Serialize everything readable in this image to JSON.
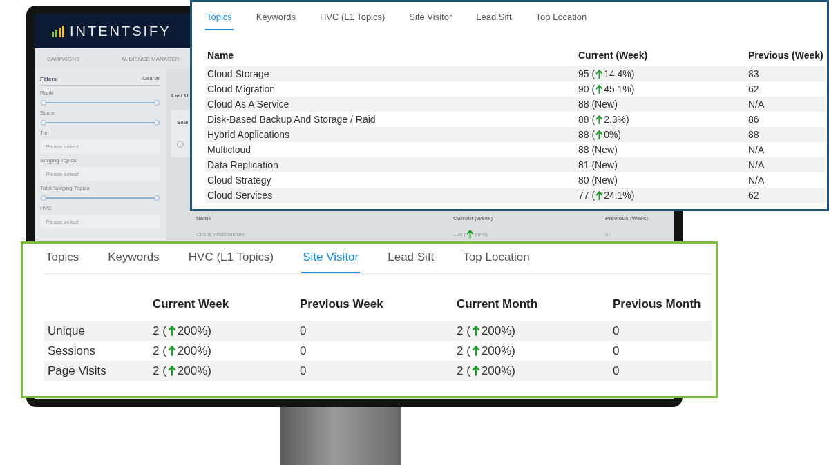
{
  "background_app": {
    "logo": "INTENTSIFY",
    "nav": [
      "CAMPAIGNS",
      "AUDIENCE MANAGER"
    ],
    "filters": {
      "title": "Filters",
      "clear": "Clear all",
      "items": [
        {
          "kind": "range",
          "label": "Rank",
          "level": 1
        },
        {
          "kind": "range",
          "label": "Score",
          "level": 1
        },
        {
          "kind": "select",
          "label": "Tier",
          "placeholder": "Please select"
        },
        {
          "kind": "select",
          "label": "Surging Topics",
          "placeholder": "Please select"
        },
        {
          "kind": "range",
          "label": "Total Surging Topics",
          "level": 1
        },
        {
          "kind": "select",
          "label": "HVC",
          "placeholder": "Please select"
        }
      ]
    },
    "main_fragments": {
      "heading": "Last U",
      "column": "Sele",
      "radio_selected": false
    },
    "table": {
      "columns": [
        "Name",
        "Current (Week)",
        "Previous (Week)"
      ],
      "rows": [
        {
          "name": "Cloud Infrastructure",
          "current": {
            "before": "100 (",
            "up": true,
            "after": "66%)"
          },
          "previous": "60"
        }
      ]
    }
  },
  "topics_panel": {
    "tabs": [
      {
        "label": "Topics",
        "selected": true
      },
      {
        "label": "Keywords",
        "selected": false
      },
      {
        "label": "HVC (L1 Topics)",
        "selected": false
      },
      {
        "label": "Site Visitor",
        "selected": false
      },
      {
        "label": "Lead Sift",
        "selected": false
      },
      {
        "label": "Top Location",
        "selected": false
      }
    ],
    "columns": [
      "Name",
      "Current (Week)",
      "Previous (Week)"
    ],
    "rows": [
      {
        "name": "Cloud Storage",
        "current": {
          "before": "95 (",
          "up": true,
          "after": "14.4%)"
        },
        "previous": "83"
      },
      {
        "name": "Cloud Migration",
        "current": {
          "before": "90 (",
          "up": true,
          "after": "45.1%)"
        },
        "previous": "62"
      },
      {
        "name": "Cloud As A Service",
        "current": {
          "before": "88 (New)",
          "up": false
        },
        "previous": "N/A"
      },
      {
        "name": "Disk-Based Backup And Storage / Raid",
        "current": {
          "before": "88 (",
          "up": true,
          "after": "2.3%)"
        },
        "previous": "86"
      },
      {
        "name": "Hybrid Applications",
        "current": {
          "before": "88 (",
          "up": true,
          "after": "0%)"
        },
        "previous": "88"
      },
      {
        "name": "Multicloud",
        "current": {
          "before": "88 (New)",
          "up": false
        },
        "previous": "N/A"
      },
      {
        "name": "Data Replication",
        "current": {
          "before": "81 (New)",
          "up": false
        },
        "previous": "N/A"
      },
      {
        "name": "Cloud Strategy",
        "current": {
          "before": "80 (New)",
          "up": false
        },
        "previous": "N/A"
      },
      {
        "name": "Cloud Services",
        "current": {
          "before": "77 (",
          "up": true,
          "after": "24.1%)"
        },
        "previous": "62"
      }
    ]
  },
  "site_visitor_panel": {
    "tabs": [
      {
        "label": "Topics",
        "selected": false
      },
      {
        "label": "Keywords",
        "selected": false
      },
      {
        "label": "HVC (L1 Topics)",
        "selected": false
      },
      {
        "label": "Site Visitor",
        "selected": true
      },
      {
        "label": "Lead Sift",
        "selected": false
      },
      {
        "label": "Top Location",
        "selected": false
      }
    ],
    "columns": [
      "Current Week",
      "Previous Week",
      "Current Month",
      "Previous Month"
    ],
    "rows": [
      {
        "label": "Unique",
        "cells": [
          {
            "before": "2 (",
            "up": true,
            "after": "200%)"
          },
          {
            "before": "0",
            "up": false
          },
          {
            "before": "2 (",
            "up": true,
            "after": "200%)"
          },
          {
            "before": "0",
            "up": false
          }
        ]
      },
      {
        "label": "Sessions",
        "cells": [
          {
            "before": "2 (",
            "up": true,
            "after": "200%)"
          },
          {
            "before": "0",
            "up": false
          },
          {
            "before": "2 (",
            "up": true,
            "after": "200%)"
          },
          {
            "before": "0",
            "up": false
          }
        ]
      },
      {
        "label": "Page Visits",
        "cells": [
          {
            "before": "2 (",
            "up": true,
            "after": "200%)"
          },
          {
            "before": "0",
            "up": false
          },
          {
            "before": "2 (",
            "up": true,
            "after": "200%)"
          },
          {
            "before": "0",
            "up": false
          }
        ]
      }
    ]
  }
}
